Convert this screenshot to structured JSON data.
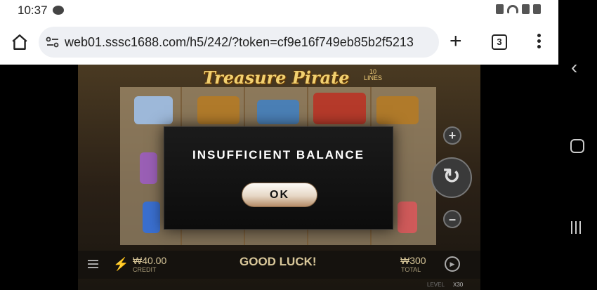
{
  "status_bar": {
    "time": "10:37",
    "talk_badge": "TALK"
  },
  "browser": {
    "url": "web01.sssc1688.com/h5/242/?token=cf9e16f749eb85b2f5213",
    "tab_count": "3"
  },
  "game": {
    "title": "Treasure Pirate",
    "lines_count": "10",
    "lines_label": "LINES",
    "credit_value": "₩40.00",
    "credit_label": "CREDIT",
    "message": "GOOD LUCK!",
    "total_value": "₩300",
    "total_label": "TOTAL",
    "level_label": "LEVEL",
    "level_value": "X30"
  },
  "dialog": {
    "title": "INSUFFICIENT BALANCE",
    "ok_label": "OK"
  }
}
